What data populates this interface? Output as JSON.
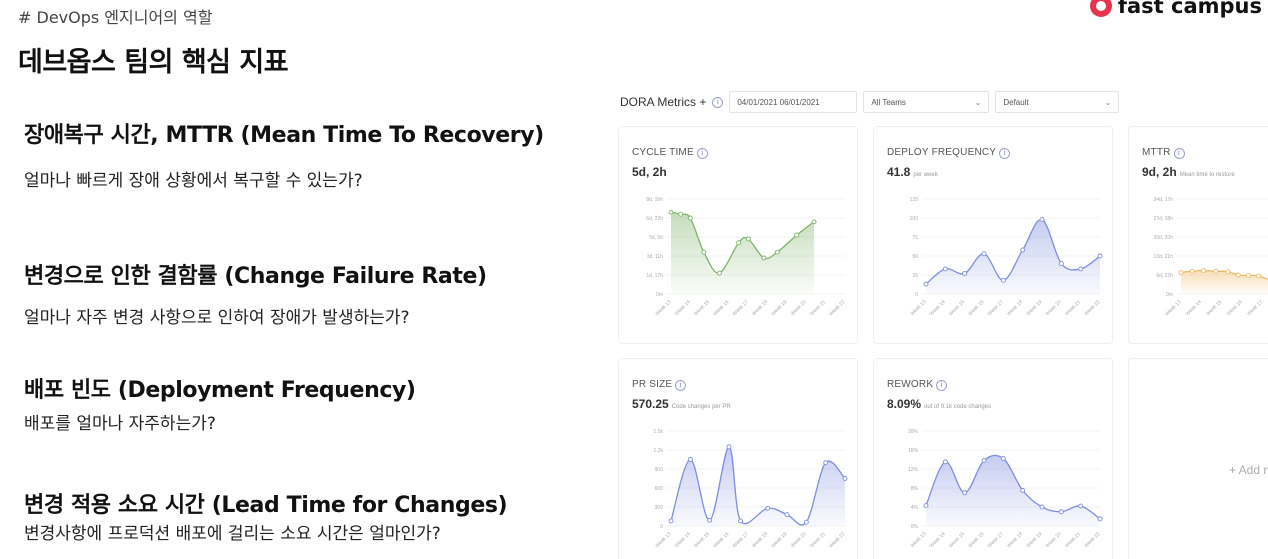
{
  "slide": {
    "tag": "# DevOps 엔지니어의 역할",
    "title": "데브옵스 팀의 핵심 지표",
    "brand": "fast campus",
    "metrics": [
      {
        "title": "장애복구 시간, MTTR (Mean Time To Recovery)",
        "desc": "얼마나 빠르게 장애 상황에서 복구할 수 있는가?"
      },
      {
        "title": "변경으로 인한 결함률 (Change Failure Rate)",
        "desc": "얼마나 자주 변경 사항으로 인하여 장애가 발생하는가?"
      },
      {
        "title": "배포 빈도 (Deployment Frequency)",
        "desc": "배포를 얼마나 자주하는가?"
      },
      {
        "title": "변경 적용 소요 시간 (Lead Time for Changes)",
        "desc": "변경사항에 프로덕션 배포에 걸리는 소요 시간은 얼마인가?"
      }
    ]
  },
  "dashboard": {
    "label": "DORA Metrics +",
    "date_range": "04/01/2021   06/01/2021",
    "teams": "All Teams",
    "view": "Default",
    "add_metric": "+ Add met",
    "colors": {
      "green": "#7fb36a",
      "blue": "#7e8de0",
      "orange": "#f0b866"
    }
  },
  "chart_data": [
    {
      "type": "area",
      "title": "CYCLE TIME",
      "value": "5d, 2h",
      "value_note": "",
      "color": "green",
      "x": [
        "Week 13",
        "Week 14",
        "Week 15",
        "Week 16",
        "Week 17",
        "Week 18",
        "Week 19",
        "Week 20",
        "Week 21",
        "Week 22"
      ],
      "ytick_labels": [
        "0m",
        "1d, 17h",
        "3d, 11h",
        "5d, 5h",
        "6d, 22h",
        "8d, 16h"
      ],
      "ylim": [
        0,
        5
      ],
      "xlim": [
        0,
        9
      ],
      "points": [
        [
          0,
          4.3
        ],
        [
          0.5,
          4.2
        ],
        [
          1,
          4.0
        ],
        [
          1.7,
          2.2
        ],
        [
          2.5,
          1.1
        ],
        [
          3.5,
          2.7
        ],
        [
          4,
          2.9
        ],
        [
          4.8,
          1.9
        ],
        [
          5.5,
          2.2
        ],
        [
          6.5,
          3.1
        ],
        [
          7.4,
          3.8
        ]
      ]
    },
    {
      "type": "area",
      "title": "DEPLOY FREQUENCY",
      "value": "41.8",
      "value_note": "per week",
      "color": "blue",
      "x": [
        "Week 13",
        "Week 14",
        "Week 15",
        "Week 16",
        "Week 17",
        "Week 18",
        "Week 19",
        "Week 20",
        "Week 21",
        "Week 22"
      ],
      "ytick_labels": [
        "0",
        "25",
        "50",
        "75",
        "100",
        "125"
      ],
      "ylim": [
        0,
        125
      ],
      "xlim": [
        0,
        9
      ],
      "points": [
        [
          0,
          13
        ],
        [
          1,
          33
        ],
        [
          2,
          27
        ],
        [
          3,
          53
        ],
        [
          4,
          18
        ],
        [
          5,
          58
        ],
        [
          6,
          98
        ],
        [
          7,
          40
        ],
        [
          8,
          33
        ],
        [
          9,
          50
        ]
      ]
    },
    {
      "type": "area",
      "title": "MTTR",
      "value": "9d, 2h",
      "value_note": "Mean time to restore",
      "color": "orange",
      "x": [
        "Week 13",
        "Week 14",
        "Week 15",
        "Week 16",
        "Week 17"
      ],
      "ytick_labels": [
        "0m",
        "6d, 22h",
        "13d, 21h",
        "20d, 20h",
        "27d, 18h",
        "34d, 17h"
      ],
      "ylim": [
        0,
        5
      ],
      "xlim": [
        0,
        4.6
      ],
      "points": [
        [
          0,
          1.13
        ],
        [
          0.55,
          1.2
        ],
        [
          1.1,
          1.23
        ],
        [
          1.7,
          1.2
        ],
        [
          2.3,
          1.17
        ],
        [
          2.8,
          1.0
        ],
        [
          3.3,
          0.97
        ],
        [
          3.8,
          0.95
        ],
        [
          4.4,
          0.72
        ]
      ]
    },
    {
      "type": "area",
      "title": "PR SIZE",
      "value": "570.25",
      "value_note": "Code changes per PR",
      "color": "blue",
      "x": [
        "Week 13",
        "Week 14",
        "Week 15",
        "Week 16",
        "Week 17",
        "Week 18",
        "Week 19",
        "Week 20",
        "Week 21",
        "Week 22"
      ],
      "ytick_labels": [
        "0",
        "300",
        "600",
        "900",
        "1.2k",
        "1.5k"
      ],
      "ylim": [
        0,
        1500
      ],
      "xlim": [
        0,
        9
      ],
      "points": [
        [
          0,
          80
        ],
        [
          1,
          1050
        ],
        [
          2,
          90
        ],
        [
          3,
          1250
        ],
        [
          3.6,
          80
        ],
        [
          5,
          280
        ],
        [
          6,
          180
        ],
        [
          7,
          60
        ],
        [
          8,
          1000
        ],
        [
          9,
          750
        ]
      ]
    },
    {
      "type": "area",
      "title": "REWORK",
      "value": "8.09%",
      "value_note": "out of 9.1k code changes",
      "color": "blue",
      "x": [
        "Week 13",
        "Week 14",
        "Week 15",
        "Week 16",
        "Week 17",
        "Week 18",
        "Week 19",
        "Week 20",
        "Week 21",
        "Week 22"
      ],
      "ytick_labels": [
        "0%",
        "4%",
        "8%",
        "12%",
        "16%",
        "20%"
      ],
      "ylim": [
        0,
        20
      ],
      "xlim": [
        0,
        9
      ],
      "points": [
        [
          0,
          4.3
        ],
        [
          1,
          13.5
        ],
        [
          2,
          7
        ],
        [
          3,
          13.8
        ],
        [
          4,
          14.2
        ],
        [
          5,
          7.5
        ],
        [
          6,
          4
        ],
        [
          7,
          3
        ],
        [
          8,
          4.2
        ],
        [
          9,
          1.5
        ]
      ]
    }
  ]
}
